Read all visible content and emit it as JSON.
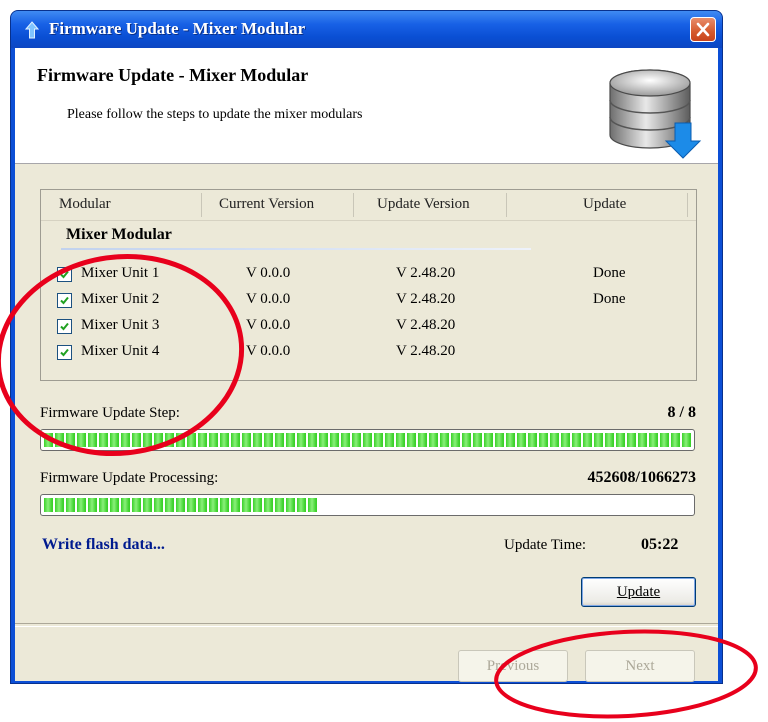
{
  "window": {
    "title": "Firmware Update - Mixer Modular"
  },
  "header": {
    "title": "Firmware Update - Mixer Modular",
    "subtitle": "Please follow the steps to update the mixer modulars"
  },
  "table": {
    "columns": [
      "Modular",
      "Current Version",
      "Update Version",
      "Update"
    ],
    "group": "Mixer Modular",
    "rows": [
      {
        "checked": true,
        "name": "Mixer Unit 1",
        "current": "V 0.0.0",
        "update_version": "V 2.48.20",
        "status": "Done"
      },
      {
        "checked": true,
        "name": "Mixer Unit 2",
        "current": "V 0.0.0",
        "update_version": "V 2.48.20",
        "status": "Done"
      },
      {
        "checked": true,
        "name": "Mixer Unit 3",
        "current": "V 0.0.0",
        "update_version": "V 2.48.20",
        "status": ""
      },
      {
        "checked": true,
        "name": "Mixer Unit 4",
        "current": "V 0.0.0",
        "update_version": "V 2.48.20",
        "status": ""
      }
    ]
  },
  "step": {
    "label": "Firmware Update Step:",
    "value": "8 / 8",
    "progress": 1.0
  },
  "processing": {
    "label": "Firmware Update Processing:",
    "value": "452608/1066273",
    "progress": 0.4245
  },
  "status_text": "Write flash data...",
  "update_time": {
    "label": "Update Time:",
    "value": "05:22"
  },
  "buttons": {
    "update": "Update",
    "previous": "Previous",
    "next": "Next"
  },
  "colors": {
    "title_bar": "#0a4fd4",
    "progress_green": "#3bd12a",
    "status_text": "#001b8f",
    "annotation": "#e8001c"
  }
}
